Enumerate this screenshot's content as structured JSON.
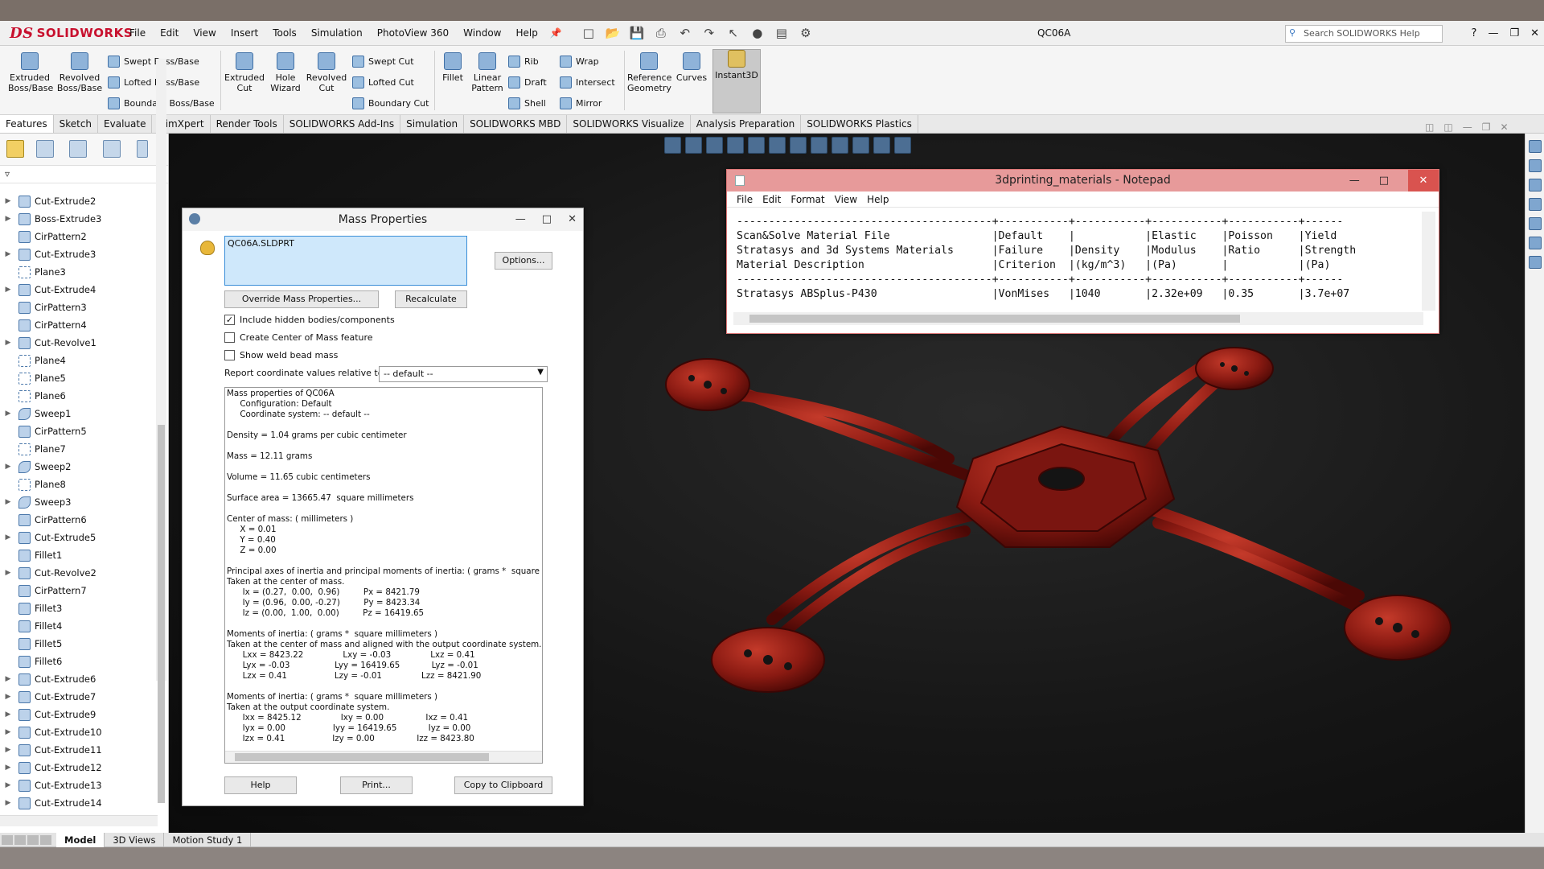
{
  "app": {
    "brand": "SOLIDWORKS",
    "document_title": "QC06A",
    "menu": [
      "File",
      "Edit",
      "View",
      "Insert",
      "Tools",
      "Simulation",
      "PhotoView 360",
      "Window",
      "Help"
    ],
    "help_search_placeholder": "Search SOLIDWORKS Help",
    "colors": {
      "brand_red": "#c8102e",
      "accent_blue": "#3a78c2",
      "model_red": "#8a1a12"
    }
  },
  "ribbon": {
    "extruded_boss": "Extruded Boss/Base",
    "revolved_boss": "Revolved Boss/Base",
    "swept_boss": "Swept Boss/Base",
    "lofted_boss": "Lofted Boss/Base",
    "boundary_boss": "Boundary Boss/Base",
    "extruded_cut": "Extruded Cut",
    "hole_wizard": "Hole Wizard",
    "revolved_cut": "Revolved Cut",
    "swept_cut": "Swept Cut",
    "lofted_cut": "Lofted Cut",
    "boundary_cut": "Boundary Cut",
    "fillet": "Fillet",
    "linear_pattern": "Linear Pattern",
    "rib": "Rib",
    "draft": "Draft",
    "shell": "Shell",
    "wrap": "Wrap",
    "intersect": "Intersect",
    "mirror": "Mirror",
    "reference_geometry": "Reference Geometry",
    "curves": "Curves",
    "instant3d": "Instant3D"
  },
  "tabs": [
    "Features",
    "Sketch",
    "Evaluate",
    "DimXpert",
    "Render Tools",
    "SOLIDWORKS Add-Ins",
    "Simulation",
    "SOLIDWORKS MBD",
    "SOLIDWORKS Visualize",
    "Analysis Preparation",
    "SOLIDWORKS Plastics"
  ],
  "feature_tree": [
    {
      "label": "Cut-Extrude2",
      "type": "feature",
      "exp": true
    },
    {
      "label": "Boss-Extrude3",
      "type": "feature",
      "exp": true
    },
    {
      "label": "CirPattern2",
      "type": "feature",
      "exp": false
    },
    {
      "label": "Cut-Extrude3",
      "type": "feature",
      "exp": true
    },
    {
      "label": "Plane3",
      "type": "plane",
      "exp": false
    },
    {
      "label": "Cut-Extrude4",
      "type": "feature",
      "exp": true
    },
    {
      "label": "CirPattern3",
      "type": "feature",
      "exp": false
    },
    {
      "label": "CirPattern4",
      "type": "feature",
      "exp": false
    },
    {
      "label": "Cut-Revolve1",
      "type": "feature",
      "exp": true
    },
    {
      "label": "Plane4",
      "type": "plane",
      "exp": false
    },
    {
      "label": "Plane5",
      "type": "plane",
      "exp": false
    },
    {
      "label": "Plane6",
      "type": "plane",
      "exp": false
    },
    {
      "label": "Sweep1",
      "type": "sweep",
      "exp": true
    },
    {
      "label": "CirPattern5",
      "type": "feature",
      "exp": false
    },
    {
      "label": "Plane7",
      "type": "plane",
      "exp": false
    },
    {
      "label": "Sweep2",
      "type": "sweep",
      "exp": true
    },
    {
      "label": "Plane8",
      "type": "plane",
      "exp": false
    },
    {
      "label": "Sweep3",
      "type": "sweep",
      "exp": true
    },
    {
      "label": "CirPattern6",
      "type": "feature",
      "exp": false
    },
    {
      "label": "Cut-Extrude5",
      "type": "feature",
      "exp": true
    },
    {
      "label": "Fillet1",
      "type": "feature",
      "exp": false
    },
    {
      "label": "Cut-Revolve2",
      "type": "feature",
      "exp": true
    },
    {
      "label": "CirPattern7",
      "type": "feature",
      "exp": false
    },
    {
      "label": "Fillet3",
      "type": "feature",
      "exp": false
    },
    {
      "label": "Fillet4",
      "type": "feature",
      "exp": false
    },
    {
      "label": "Fillet5",
      "type": "feature",
      "exp": false
    },
    {
      "label": "Fillet6",
      "type": "feature",
      "exp": false
    },
    {
      "label": "Cut-Extrude6",
      "type": "feature",
      "exp": true
    },
    {
      "label": "Cut-Extrude7",
      "type": "feature",
      "exp": true
    },
    {
      "label": "Cut-Extrude9",
      "type": "feature",
      "exp": true
    },
    {
      "label": "Cut-Extrude10",
      "type": "feature",
      "exp": true
    },
    {
      "label": "Cut-Extrude11",
      "type": "feature",
      "exp": true
    },
    {
      "label": "Cut-Extrude12",
      "type": "feature",
      "exp": true
    },
    {
      "label": "Cut-Extrude13",
      "type": "feature",
      "exp": true
    },
    {
      "label": "Cut-Extrude14",
      "type": "feature",
      "exp": true
    }
  ],
  "bottom_tabs": [
    "Model",
    "3D Views",
    "Motion Study 1"
  ],
  "mass_properties": {
    "title": "Mass Properties",
    "selection": "QC06A.SLDPRT",
    "options": "Options...",
    "override": "Override Mass Properties...",
    "recalculate": "Recalculate",
    "include_hidden": "Include hidden bodies/components",
    "create_com": "Create Center of Mass feature",
    "show_weld": "Show weld bead mass",
    "report_label": "Report coordinate values relative to:",
    "coord_value": "-- default --",
    "help": "Help",
    "print": "Print...",
    "copy": "Copy to Clipboard",
    "output": [
      "Mass properties of QC06A",
      "     Configuration: Default",
      "     Coordinate system: -- default --",
      "",
      "Density = 1.04 grams per cubic centimeter",
      "",
      "Mass = 12.11 grams",
      "",
      "Volume = 11.65 cubic centimeters",
      "",
      "Surface area = 13665.47  square millimeters",
      "",
      "Center of mass: ( millimeters )",
      "     X = 0.01",
      "     Y = 0.40",
      "     Z = 0.00",
      "",
      "Principal axes of inertia and principal moments of inertia: ( grams *  square millimeters )",
      "Taken at the center of mass.",
      "      Ix = (0.27,  0.00,  0.96)         Px = 8421.79",
      "      Iy = (0.96,  0.00, -0.27)         Py = 8423.34",
      "      Iz = (0.00,  1.00,  0.00)         Pz = 16419.65",
      "",
      "Moments of inertia: ( grams *  square millimeters )",
      "Taken at the center of mass and aligned with the output coordinate system.",
      "      Lxx = 8423.22               Lxy = -0.03               Lxz = 0.41",
      "      Lyx = -0.03                 Lyy = 16419.65            Lyz = -0.01",
      "      Lzx = 0.41                  Lzy = -0.01               Lzz = 8421.90",
      "",
      "Moments of inertia: ( grams *  square millimeters )",
      "Taken at the output coordinate system.",
      "      Ixx = 8425.12               Ixy = 0.00                Ixz = 0.41",
      "      Iyx = 0.00                  Iyy = 16419.65            Iyz = 0.00",
      "      Izx = 0.41                  Izy = 0.00                Izz = 8423.80"
    ]
  },
  "notepad": {
    "title": "3dprinting_materials - Notepad",
    "menu": [
      "File",
      "Edit",
      "Format",
      "View",
      "Help"
    ],
    "lines": [
      "----------------------------------------+-----------+-----------+-----------+-----------+------",
      "Scan&Solve Material File                |Default    |           |Elastic    |Poisson    |Yield",
      "Stratasys and 3d Systems Materials      |Failure    |Density    |Modulus    |Ratio      |Strength",
      "Material Description                    |Criterion  |(kg/m^3)   |(Pa)       |           |(Pa)",
      "----------------------------------------+-----------+-----------+-----------+-----------+------",
      "Stratasys ABSplus-P430                  |VonMises   |1040       |2.32e+09   |0.35       |3.7e+07"
    ]
  }
}
